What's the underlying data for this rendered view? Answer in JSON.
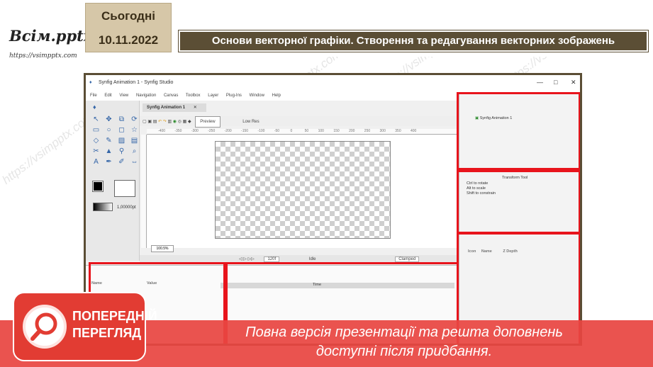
{
  "header": {
    "logo_text": "Всім.pptx",
    "logo_url": "https://vsimpptx.com",
    "today_label": "Сьогодні",
    "date": "10.11.2022",
    "slide_title": "Основи векторної графіки. Створення та редагування векторних зображень"
  },
  "screenshot": {
    "window_title": "Synfig Animation 1 - Synfig Studio",
    "menu": [
      "File",
      "Edit",
      "View",
      "Navigation",
      "Canvas",
      "Toolbox",
      "Layer",
      "Plug-Ins",
      "Window",
      "Help"
    ],
    "doc_tab": "Synfig Animation 1",
    "preview_label": "Preview",
    "low_res_label": "Low Res",
    "ruler_ticks": [
      "-400",
      "-350",
      "-300",
      "-250",
      "-200",
      "-150",
      "-100",
      "-50",
      "0",
      "50",
      "100",
      "150",
      "200",
      "250",
      "300",
      "350",
      "400"
    ],
    "zoom": "100.5%",
    "end_time": "120f",
    "state": "Idle",
    "interpolation": "Clamped",
    "stroke_width": "1,00000pt",
    "canvas_browser_item": "Synfig Animation 1",
    "tool_name": "Transform Tool",
    "tool_hints": [
      "Ctrl to rotate",
      "Alt to scale",
      "Shift to constrain"
    ],
    "layers_columns": [
      "Icon",
      "Name",
      "Z Depth"
    ],
    "params_columns": [
      "Name",
      "Value"
    ],
    "timetrack_label": "Time"
  },
  "overlay": {
    "badge_line1": "ПОПЕРЕДНІЙ",
    "badge_line2": "ПЕРЕГЛЯД",
    "banner_line1": "Повна версія презентації та решта доповнень",
    "banner_line2": "доступні після придбання.",
    "watermark": "https://vsimpptx.com"
  },
  "colors": {
    "title_bar": "#5b4e35",
    "date_box": "#d6c7a8",
    "highlight": "#e8141c",
    "banner": "#e84642"
  }
}
